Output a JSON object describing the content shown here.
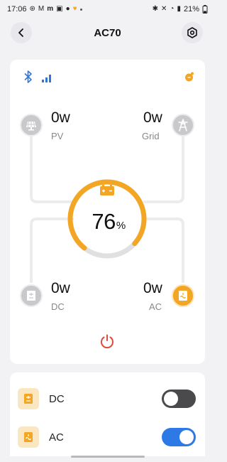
{
  "status_bar": {
    "time": "17:06",
    "left_icons": [
      "circle-badge-icon",
      "gmail-icon",
      "m-icon",
      "note-icon",
      "chat-icon",
      "heart-icon"
    ],
    "battery_text": "21%"
  },
  "header": {
    "title": "AC70"
  },
  "nodes": {
    "pv": {
      "value": "0w",
      "label": "PV",
      "active": false,
      "icon": "solar-panel-icon"
    },
    "grid": {
      "value": "0w",
      "label": "Grid",
      "active": false,
      "icon": "power-tower-icon"
    },
    "dc": {
      "value": "0w",
      "label": "DC",
      "active": false,
      "icon": "dc-port-icon"
    },
    "ac": {
      "value": "0w",
      "label": "AC",
      "active": true,
      "icon": "ac-outlet-icon"
    }
  },
  "battery": {
    "percent": "76",
    "unit": "%",
    "level_fraction": 0.76
  },
  "outputs": [
    {
      "label": "DC",
      "on": false
    },
    {
      "label": "AC",
      "on": true
    }
  ],
  "colors": {
    "accent": "#f3a624",
    "toggle_on": "#2d79e6",
    "toggle_off": "#4a4a4c",
    "bluetooth": "#2f77d8",
    "power": "#e0493e",
    "inactive_node": "#c9c9cc"
  }
}
